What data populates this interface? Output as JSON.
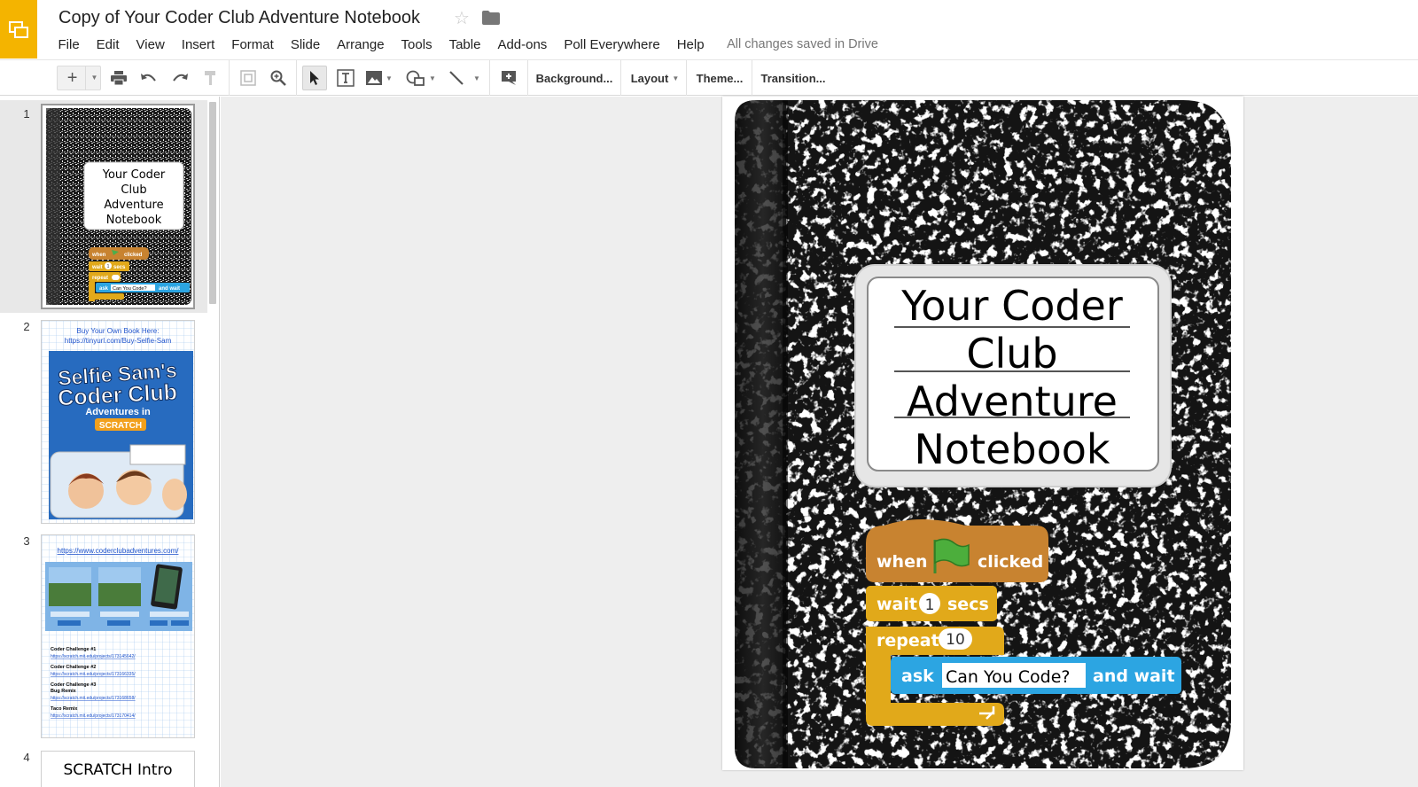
{
  "header": {
    "doc_title": "Copy of Your Coder Club Adventure Notebook",
    "save_status": "All changes saved in Drive",
    "icons": [
      "slides-logo-icon",
      "star-icon",
      "folder-icon"
    ]
  },
  "menu": [
    "File",
    "Edit",
    "View",
    "Insert",
    "Format",
    "Slide",
    "Arrange",
    "Tools",
    "Table",
    "Add-ons",
    "Poll Everywhere",
    "Help"
  ],
  "toolbar": {
    "background_label": "Background...",
    "layout_label": "Layout",
    "theme_label": "Theme...",
    "transition_label": "Transition..."
  },
  "filmstrip": {
    "selected": 1,
    "slides": [
      {
        "number": "1"
      },
      {
        "number": "2",
        "link_line1": "Buy Your Own Book Here:",
        "link_line2": "https://tinyurl.com/Buy-Selfie-Sam",
        "book_title1": "Selfie Sam's",
        "book_title2": "Coder Club",
        "book_title3": "Adventures in",
        "book_title4": "SCRATCH"
      },
      {
        "number": "3",
        "site_link": "https://www.coderclubadventures.com/",
        "challenges": [
          {
            "title": "Coder Challenge #1",
            "link": "https://scratch.mit.edu/projects/173145642/"
          },
          {
            "title": "Coder Challenge #2",
            "link": "https://scratch.mit.edu/projects/173166335/"
          },
          {
            "title": "Coder Challenge #3",
            "sub": "Bug Remix",
            "link": "https://scratch.mit.edu/projects/173168658/"
          },
          {
            "title": "Taco Remix",
            "link": "https://scratch.mit.edu/projects/173170414/"
          }
        ]
      },
      {
        "number": "4",
        "title": "SCRATCH Intro"
      }
    ]
  },
  "slide": {
    "label_lines": [
      "Your Coder",
      "Club",
      "Adventure",
      "Notebook"
    ],
    "blocks": {
      "when": "when",
      "clicked": "clicked",
      "wait": "wait",
      "wait_value": "1",
      "secs": "secs",
      "repeat": "repeat",
      "repeat_value": "10",
      "ask": "ask",
      "ask_value": "Can You Code?",
      "and_wait": "and wait"
    }
  }
}
